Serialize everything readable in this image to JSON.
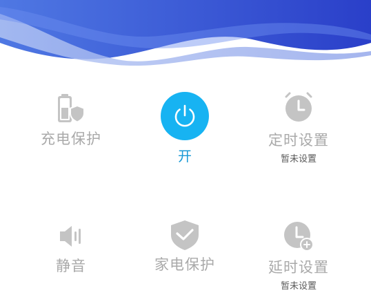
{
  "colors": {
    "accent": "#17b3f2",
    "accent_text": "#1a9ad6",
    "icon_gray": "#c4c4c4",
    "label_gray": "#a9a9a9",
    "header_blue": "#2f52d6"
  },
  "controls": {
    "charge_protect": {
      "label": "充电保护",
      "icon": "battery-shield-icon"
    },
    "power": {
      "label": "开",
      "icon": "power-icon"
    },
    "timer": {
      "label": "定时设置",
      "status": "暂未设置",
      "icon": "alarm-clock-icon"
    },
    "mute": {
      "label": "静音",
      "icon": "speaker-icon"
    },
    "home_protect": {
      "label": "家电保护",
      "icon": "shield-check-icon"
    },
    "delay": {
      "label": "延时设置",
      "status": "暂未设置",
      "icon": "clock-plus-icon"
    }
  }
}
